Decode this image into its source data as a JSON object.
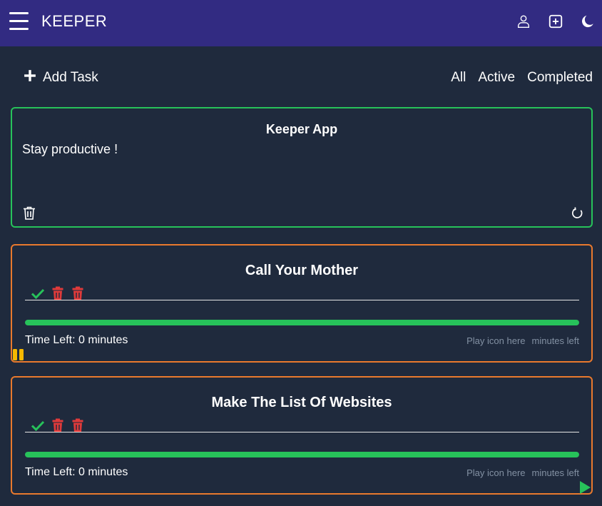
{
  "app": {
    "title": "KEEPER"
  },
  "header": {
    "icons": [
      "menu-icon",
      "user-icon",
      "add-box-icon",
      "moon-icon"
    ]
  },
  "toolbar": {
    "add_task_label": "Add Task"
  },
  "filters": [
    {
      "label": "All"
    },
    {
      "label": "Active"
    },
    {
      "label": "Completed"
    }
  ],
  "note": {
    "title": "Keeper App",
    "body": "Stay productive !"
  },
  "tasks": [
    {
      "title": "Call Your Mother",
      "time_left": "Time Left: 0 minutes",
      "hint_play": "Play icon here",
      "hint_minutes": "minutes left",
      "progress": 1.0,
      "control": "pause-icon"
    },
    {
      "title": "Make The List Of Websites",
      "time_left": "Time Left: 0 minutes",
      "hint_play": "Play icon here",
      "hint_minutes": "minutes left",
      "progress": 1.0,
      "control": "play-icon"
    }
  ],
  "colors": {
    "background": "#1f2a3d",
    "topbar": "#322b82",
    "note_border": "#27c25a",
    "task_border": "#e9792d",
    "progress": "#27c25a",
    "check": "#27c25a",
    "delete": "#e03a3a",
    "pause": "#f5b800",
    "play": "#27c25a"
  }
}
